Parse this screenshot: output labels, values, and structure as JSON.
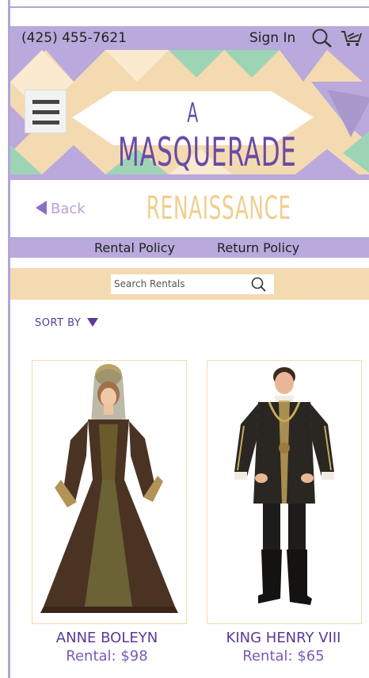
{
  "header": {
    "phone": "(425) 455-7621",
    "sign_in": "Sign In",
    "search_icon": "search-icon",
    "cart_icon": "cart-icon"
  },
  "logo": {
    "line1": "A",
    "line2": "MASQUERADE"
  },
  "nav": {
    "back_label": "Back",
    "page_title": "RENAISSANCE"
  },
  "policies": {
    "rental": "Rental Policy",
    "return": "Return Policy"
  },
  "search": {
    "placeholder": "Search Rentals"
  },
  "sort": {
    "label": "SORT BY"
  },
  "products": [
    {
      "name": "ANNE BOLEYN",
      "price": "Rental: $98"
    },
    {
      "name": "KING HENRY VIII",
      "price": "Rental: $65"
    }
  ],
  "colors": {
    "accent_purple": "#b9a9dc",
    "accent_tan": "#f4dab0",
    "title_gold": "#f0cf8d",
    "text_purple": "#5a3a9a"
  }
}
